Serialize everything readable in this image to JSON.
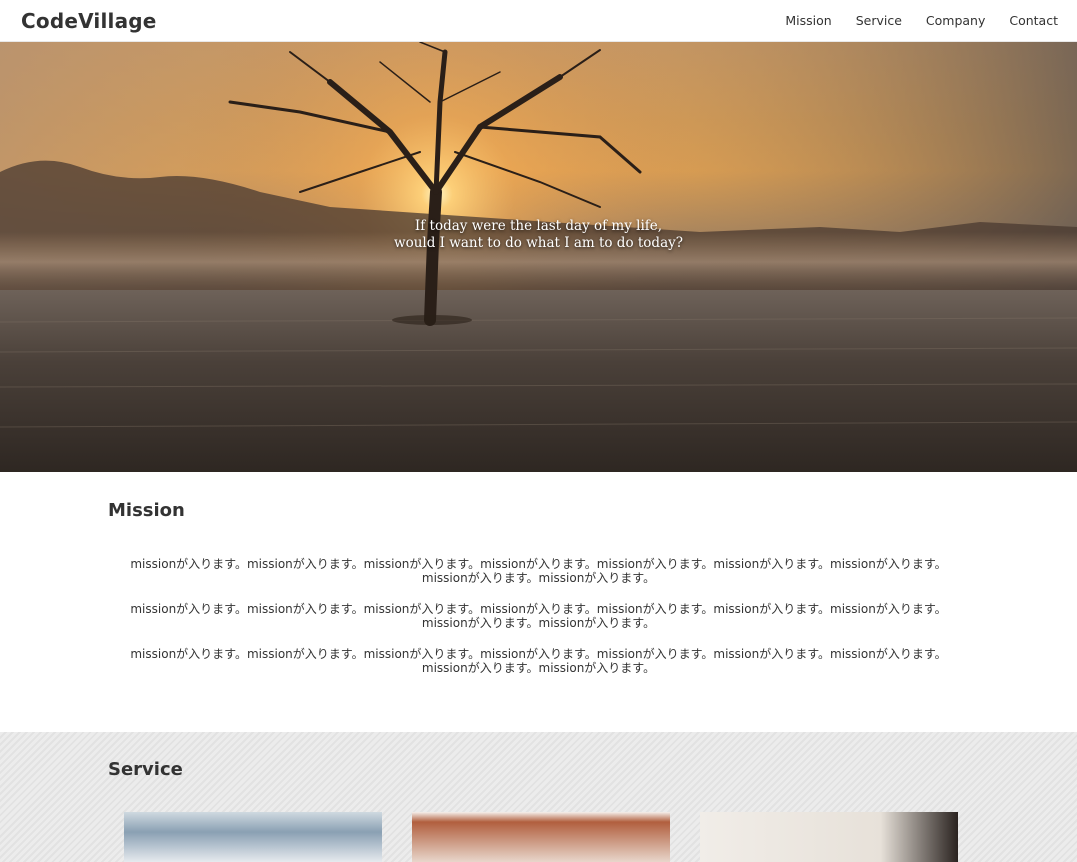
{
  "header": {
    "logo": "CodeVillage",
    "nav": [
      "Mission",
      "Service",
      "Company",
      "Contact"
    ]
  },
  "hero": {
    "line1": "If today were the last day of my life,",
    "line2": "would I want to do what I am to do today?"
  },
  "mission": {
    "title": "Mission",
    "paragraphs": [
      "missionが入ります。missionが入ります。missionが入ります。missionが入ります。missionが入ります。missionが入ります。missionが入ります。missionが入ります。missionが入ります。",
      "missionが入ります。missionが入ります。missionが入ります。missionが入ります。missionが入ります。missionが入ります。missionが入ります。missionが入ります。missionが入ります。",
      "missionが入ります。missionが入ります。missionが入ります。missionが入ります。missionが入ります。missionが入ります。missionが入ります。missionが入ります。missionが入ります。"
    ]
  },
  "service": {
    "title": "Service"
  }
}
